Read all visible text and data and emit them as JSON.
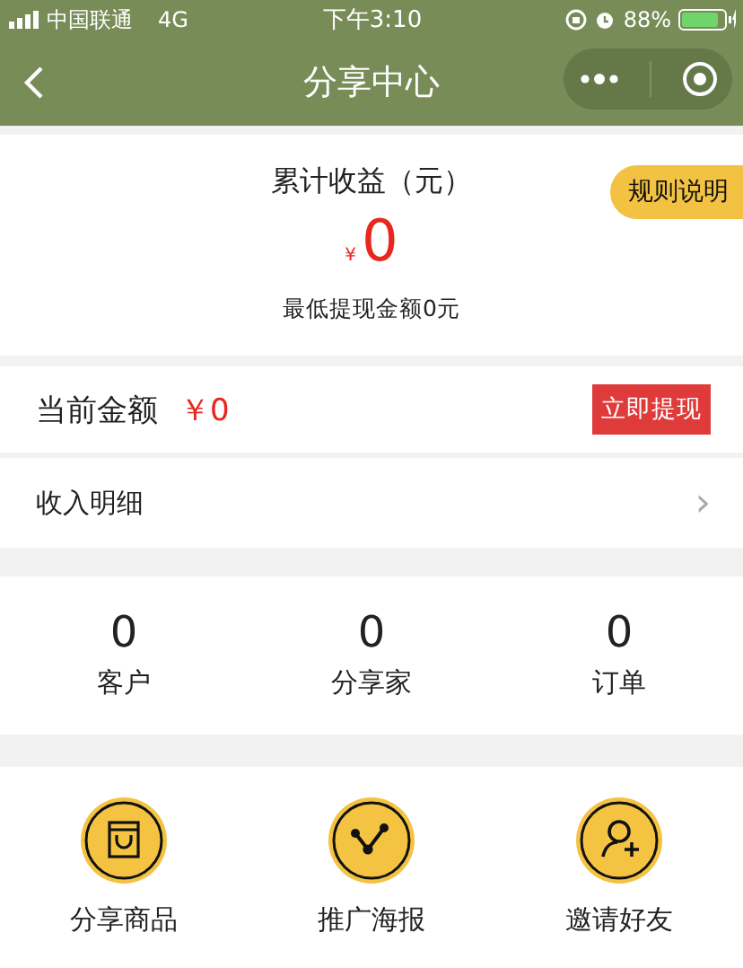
{
  "status_bar": {
    "carrier": "中国联通",
    "network": "4G",
    "time": "下午3:10",
    "battery": "88%"
  },
  "nav": {
    "title": "分享中心"
  },
  "earnings": {
    "title": "累计收益（元）",
    "currency": "¥",
    "amount": "0",
    "note": "最低提现金额0元",
    "rules_button": "规则说明"
  },
  "balance": {
    "label": "当前金额",
    "value": "￥0",
    "withdraw_button": "立即提现"
  },
  "detail_row": {
    "label": "收入明细",
    "chevron": "›"
  },
  "stats": [
    {
      "value": "0",
      "label": "客户"
    },
    {
      "value": "0",
      "label": "分享家"
    },
    {
      "value": "0",
      "label": "订单"
    }
  ],
  "actions": [
    {
      "kind": "bag",
      "label": "分享商品"
    },
    {
      "kind": "share",
      "label": "推广海报"
    },
    {
      "kind": "invite",
      "label": "邀请好友"
    }
  ]
}
